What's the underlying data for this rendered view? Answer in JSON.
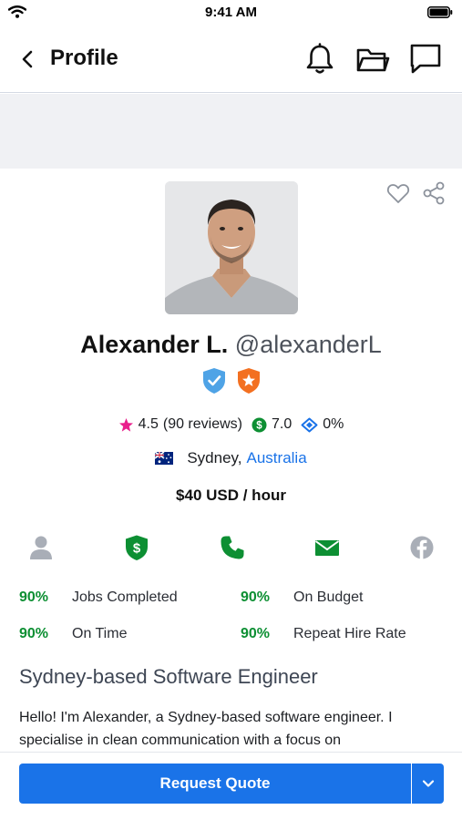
{
  "status_bar": {
    "time": "9:41 AM"
  },
  "nav": {
    "title": "Profile"
  },
  "profile": {
    "name": "Alexander L.",
    "username": "@alexanderL",
    "rating": "4.5",
    "reviews": "(90 reviews)",
    "earnings_score": "7.0",
    "percentage": "0%",
    "city": "Sydney,",
    "country": "Australia",
    "hourly_rate": "$40 USD / hour"
  },
  "metrics": [
    {
      "pct": "90%",
      "label": "Jobs Completed"
    },
    {
      "pct": "90%",
      "label": "On Budget"
    },
    {
      "pct": "90%",
      "label": "On Time"
    },
    {
      "pct": "90%",
      "label": "Repeat Hire Rate"
    }
  ],
  "headline": "Sydney-based Software Engineer",
  "bio": "Hello! I'm Alexander, a Sydney-based software engineer. I specialise in clean communication with a focus on",
  "cta": {
    "label": "Request Quote"
  },
  "icons": {
    "verification": [
      "user-icon",
      "payment-verified-icon",
      "phone-icon",
      "email-icon",
      "facebook-icon"
    ],
    "badges": [
      "verified-shield-icon",
      "preferred-freelancer-icon"
    ]
  },
  "colors": {
    "accent": "#1a73e8",
    "success": "#0d8f33",
    "star": "#e91e8c",
    "muted_icon": "#a9aeb7",
    "badge_blue": "#4fa3e6",
    "badge_orange": "#f37021"
  }
}
